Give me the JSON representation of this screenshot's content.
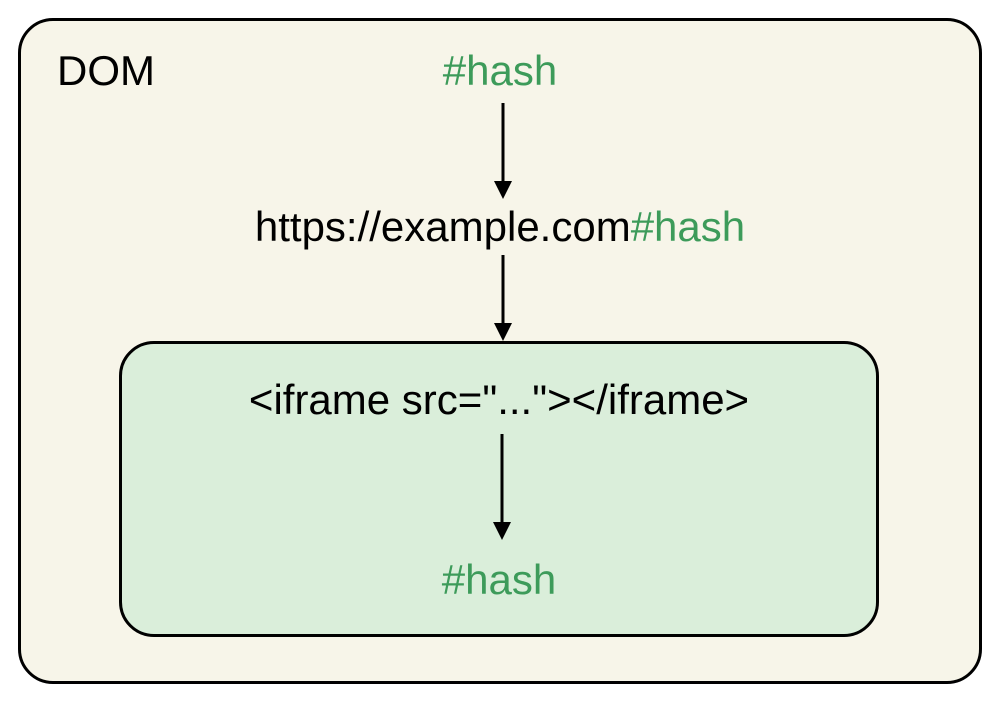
{
  "diagram": {
    "container_label": "DOM",
    "top_hash": "#hash",
    "url": {
      "base": "https://example.com",
      "hash": "#hash"
    },
    "iframe_code": "<iframe src=\"...\"></iframe>",
    "bottom_hash": "#hash",
    "colors": {
      "outer_bg": "#f7f5e9",
      "inner_bg": "#daeeda",
      "hash_color": "#3d9b5a",
      "border": "#000000"
    }
  }
}
